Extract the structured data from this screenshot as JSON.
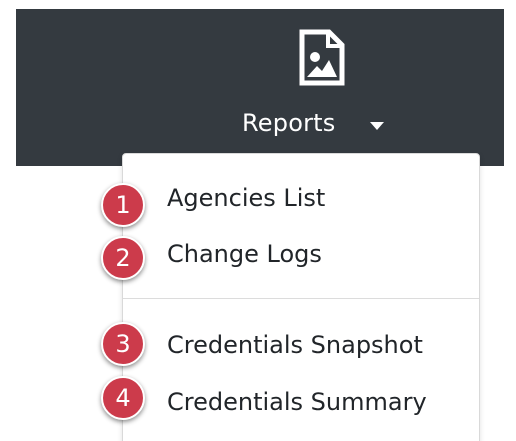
{
  "colors": {
    "navbar_background": "#343a40",
    "badge": "#cc3b4b",
    "menu_text": "#212529"
  },
  "nav": {
    "icon": "report-image-icon",
    "label": "Reports",
    "caret_icon": "caret-down-icon"
  },
  "dropdown": {
    "items": [
      {
        "label": "Agencies List",
        "badge": "1"
      },
      {
        "label": "Change Logs",
        "badge": "2"
      },
      {
        "label": "Credentials Snapshot",
        "badge": "3"
      },
      {
        "label": "Credentials Summary",
        "badge": "4"
      }
    ]
  }
}
